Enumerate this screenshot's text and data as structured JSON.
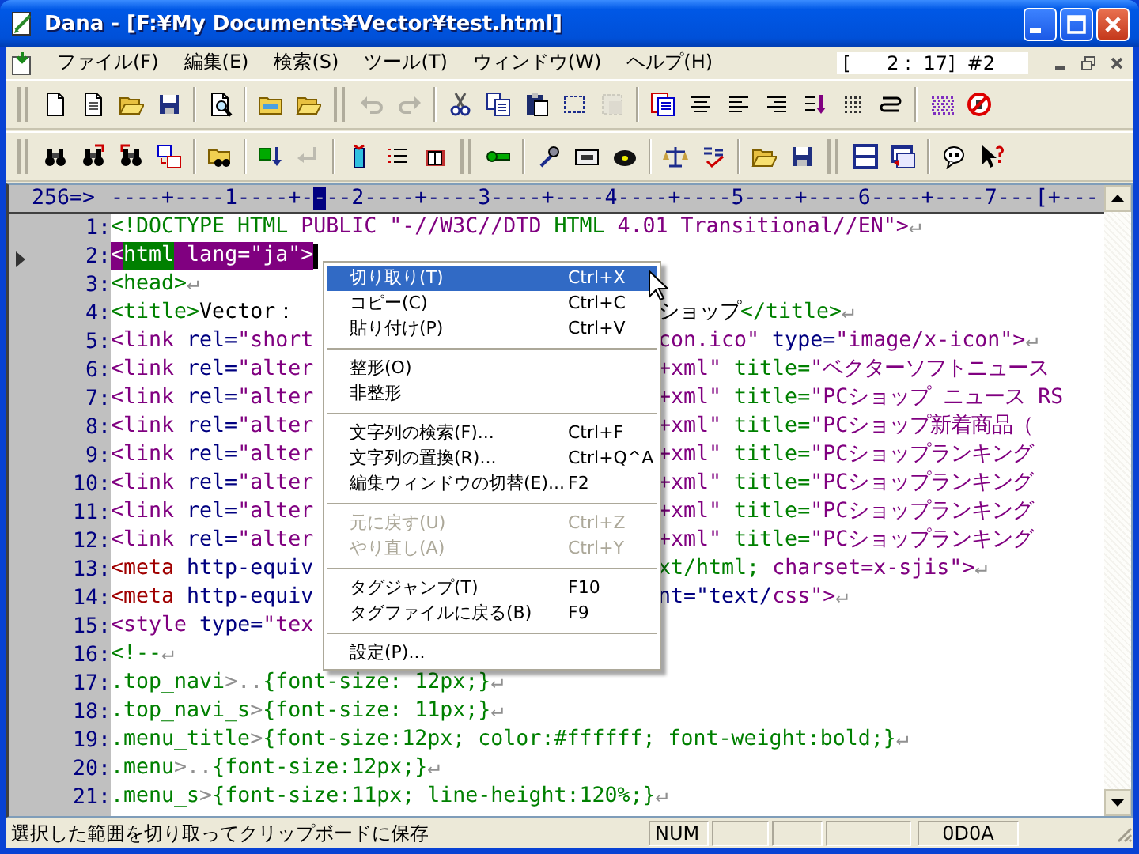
{
  "window": {
    "title": "Dana - [F:¥My Documents¥Vector¥test.html]"
  },
  "menu_bar": {
    "items": [
      "ファイル(F)",
      "編集(E)",
      "検索(S)",
      "ツール(T)",
      "ウィンドウ(W)",
      "ヘルプ(H)"
    ],
    "position": "[      2 :  17]  #2"
  },
  "toolbars": [
    {
      "groups": [
        {
          "buttons": [
            {
              "disabled": false
            },
            {
              "disabled": false
            },
            {
              "disabled": false
            },
            {
              "disabled": false
            }
          ]
        },
        {
          "buttons": [
            {
              "disabled": false
            }
          ]
        },
        {
          "buttons": [
            {
              "disabled": false
            },
            {
              "disabled": false
            }
          ]
        },
        {
          "buttons": [
            {
              "disabled": true
            },
            {
              "disabled": true
            }
          ]
        },
        {
          "buttons": [
            {
              "disabled": false
            },
            {
              "disabled": false
            },
            {
              "disabled": false
            },
            {
              "disabled": false
            },
            {
              "disabled": true
            }
          ]
        },
        {
          "buttons": [
            {
              "disabled": false
            },
            {
              "disabled": false
            },
            {
              "disabled": false
            },
            {
              "disabled": false
            },
            {
              "disabled": false
            },
            {
              "disabled": false
            },
            {
              "disabled": false
            }
          ]
        },
        {
          "buttons": [
            {
              "disabled": false
            },
            {
              "disabled": false
            }
          ]
        }
      ]
    },
    {
      "groups": [
        {
          "buttons": [
            {
              "disabled": false
            },
            {
              "disabled": false
            },
            {
              "disabled": false
            },
            {
              "disabled": false
            }
          ]
        },
        {
          "buttons": [
            {
              "disabled": false
            }
          ]
        },
        {
          "buttons": [
            {
              "disabled": false
            },
            {
              "disabled": true
            }
          ]
        },
        {
          "buttons": [
            {
              "disabled": false
            },
            {
              "disabled": false
            },
            {
              "disabled": false
            }
          ]
        },
        {
          "buttons": [
            {
              "disabled": false
            }
          ]
        },
        {
          "buttons": [
            {
              "disabled": false
            },
            {
              "disabled": false
            },
            {
              "disabled": false
            }
          ]
        },
        {
          "buttons": [
            {
              "disabled": false
            },
            {
              "disabled": false
            }
          ]
        },
        {
          "buttons": [
            {
              "disabled": false
            },
            {
              "disabled": false
            }
          ]
        },
        {
          "buttons": [
            {
              "disabled": false
            },
            {
              "disabled": false
            }
          ]
        },
        {
          "buttons": [
            {
              "disabled": false
            },
            {
              "disabled": false
            }
          ]
        }
      ]
    }
  ],
  "ruler": {
    "label": "256=>",
    "before": "----+----1----+-",
    "cursor": "-",
    "after": "--2----+----3----+----4----+----5----+----6----+----7---[+---"
  },
  "lines": [
    {
      "number": "1:",
      "current": false,
      "left": [
        {
          "kind": "tag",
          "text": "<!DOCTYPE HTML "
        },
        {
          "kind": "value",
          "text": "PUBLIC \"-//W3C//DTD "
        },
        {
          "kind": "tag",
          "text": "HTML "
        },
        {
          "kind": "value",
          "text": "4.01 Transitional//EN\">"
        },
        {
          "kind": "eol",
          "text": "↵"
        }
      ]
    },
    {
      "number": "2:",
      "current": true,
      "left": [
        {
          "kind": "value",
          "text": "<",
          "selected": true
        },
        {
          "kind": "tag",
          "text": "html",
          "selected": true
        },
        {
          "kind": "value",
          "text": " lang=\"ja\">",
          "selected": true
        }
      ]
    },
    {
      "number": "3:",
      "current": false,
      "left": [
        {
          "kind": "tag",
          "text": "<head>"
        },
        {
          "kind": "eol",
          "text": "↵"
        }
      ]
    },
    {
      "number": "4:",
      "current": false,
      "left": [
        {
          "kind": "tag",
          "text": "<title>"
        },
        {
          "kind": "text",
          "text": "Vector："
        }
      ],
      "right": [
        {
          "kind": "text",
          "text": "ショップ"
        },
        {
          "kind": "tag",
          "text": "</title>"
        },
        {
          "kind": "eol",
          "text": "↵"
        }
      ]
    },
    {
      "number": "5:",
      "current": false,
      "left": [
        {
          "kind": "value",
          "text": "<link"
        },
        {
          "kind": "attr",
          "text": " rel="
        },
        {
          "kind": "value",
          "text": "\"short"
        }
      ],
      "right": [
        {
          "kind": "value",
          "text": "con.ico\""
        },
        {
          "kind": "attr",
          "text": " type="
        },
        {
          "kind": "value",
          "text": "\"image/x-icon\">"
        },
        {
          "kind": "eol",
          "text": "↵"
        }
      ]
    },
    {
      "number": "6:",
      "current": false,
      "left": [
        {
          "kind": "value",
          "text": "<link"
        },
        {
          "kind": "attr",
          "text": " rel="
        },
        {
          "kind": "value",
          "text": "\"alter"
        }
      ],
      "right": [
        {
          "kind": "value",
          "text": "+xml\""
        },
        {
          "kind": "tag",
          "text": " title="
        },
        {
          "kind": "value",
          "text": "\"ベクターソフトニュース"
        }
      ]
    },
    {
      "number": "7:",
      "current": false,
      "left": [
        {
          "kind": "value",
          "text": "<link"
        },
        {
          "kind": "attr",
          "text": " rel="
        },
        {
          "kind": "value",
          "text": "\"alter"
        }
      ],
      "right": [
        {
          "kind": "value",
          "text": "+xml\""
        },
        {
          "kind": "tag",
          "text": " title="
        },
        {
          "kind": "value",
          "text": "\"PCショップ ニュース RS"
        }
      ]
    },
    {
      "number": "8:",
      "current": false,
      "left": [
        {
          "kind": "value",
          "text": "<link"
        },
        {
          "kind": "attr",
          "text": " rel="
        },
        {
          "kind": "value",
          "text": "\"alter"
        }
      ],
      "right": [
        {
          "kind": "value",
          "text": "+xml\""
        },
        {
          "kind": "tag",
          "text": " title="
        },
        {
          "kind": "value",
          "text": "\"PCショップ新着商品（"
        }
      ]
    },
    {
      "number": "9:",
      "current": false,
      "left": [
        {
          "kind": "value",
          "text": "<link"
        },
        {
          "kind": "attr",
          "text": " rel="
        },
        {
          "kind": "value",
          "text": "\"alter"
        }
      ],
      "right": [
        {
          "kind": "value",
          "text": "+xml\""
        },
        {
          "kind": "tag",
          "text": " title="
        },
        {
          "kind": "value",
          "text": "\"PCショップランキング"
        }
      ]
    },
    {
      "number": "10:",
      "current": false,
      "left": [
        {
          "kind": "value",
          "text": "<link"
        },
        {
          "kind": "attr",
          "text": " rel="
        },
        {
          "kind": "value",
          "text": "\"alter"
        }
      ],
      "right": [
        {
          "kind": "value",
          "text": "+xml\""
        },
        {
          "kind": "tag",
          "text": " title="
        },
        {
          "kind": "value",
          "text": "\"PCショップランキング"
        }
      ]
    },
    {
      "number": "11:",
      "current": false,
      "left": [
        {
          "kind": "value",
          "text": "<link"
        },
        {
          "kind": "attr",
          "text": " rel="
        },
        {
          "kind": "value",
          "text": "\"alter"
        }
      ],
      "right": [
        {
          "kind": "value",
          "text": "+xml\""
        },
        {
          "kind": "tag",
          "text": " title="
        },
        {
          "kind": "value",
          "text": "\"PCショップランキング"
        }
      ]
    },
    {
      "number": "12:",
      "current": false,
      "left": [
        {
          "kind": "value",
          "text": "<link"
        },
        {
          "kind": "attr",
          "text": " rel="
        },
        {
          "kind": "value",
          "text": "\"alter"
        }
      ],
      "right": [
        {
          "kind": "value",
          "text": "+xml\""
        },
        {
          "kind": "tag",
          "text": " title="
        },
        {
          "kind": "value",
          "text": "\"PCショップランキング"
        }
      ]
    },
    {
      "number": "13:",
      "current": false,
      "left": [
        {
          "kind": "meta",
          "text": "<meta"
        },
        {
          "kind": "attr",
          "text": " http-equiv"
        }
      ],
      "right": [
        {
          "kind": "tag",
          "text": "xt/html; "
        },
        {
          "kind": "value",
          "text": "charset=x-sjis\">"
        },
        {
          "kind": "eol",
          "text": "↵"
        }
      ]
    },
    {
      "number": "14:",
      "current": false,
      "left": [
        {
          "kind": "meta",
          "text": "<meta"
        },
        {
          "kind": "attr",
          "text": " http-equiv"
        }
      ],
      "right": [
        {
          "kind": "attr",
          "text": "nt=\"text/"
        },
        {
          "kind": "value",
          "text": "css\">"
        },
        {
          "kind": "eol",
          "text": "↵"
        }
      ]
    },
    {
      "number": "15:",
      "current": false,
      "left": [
        {
          "kind": "value",
          "text": "<style"
        },
        {
          "kind": "attr",
          "text": " type="
        },
        {
          "kind": "value",
          "text": "\"tex"
        }
      ]
    },
    {
      "number": "16:",
      "current": false,
      "left": [
        {
          "kind": "tag",
          "text": "<!--"
        },
        {
          "kind": "eol",
          "text": "↵"
        }
      ]
    },
    {
      "number": "17:",
      "current": false,
      "left": [
        {
          "kind": "tag",
          "text": ".top_navi"
        },
        {
          "kind": "eol",
          "text": ">.."
        },
        {
          "kind": "tag",
          "text": "{font-size: 12px;}"
        },
        {
          "kind": "eol",
          "text": "↵"
        }
      ]
    },
    {
      "number": "18:",
      "current": false,
      "left": [
        {
          "kind": "tag",
          "text": ".top_navi_s"
        },
        {
          "kind": "eol",
          "text": ">"
        },
        {
          "kind": "tag",
          "text": "{font-size: 11px;}"
        },
        {
          "kind": "eol",
          "text": "↵"
        }
      ]
    },
    {
      "number": "19:",
      "current": false,
      "left": [
        {
          "kind": "tag",
          "text": ".menu_title"
        },
        {
          "kind": "eol",
          "text": ">"
        },
        {
          "kind": "tag",
          "text": "{font-size:12px; color:#ffffff; font-weight:bold;}"
        },
        {
          "kind": "eol",
          "text": "↵"
        }
      ]
    },
    {
      "number": "20:",
      "current": false,
      "left": [
        {
          "kind": "tag",
          "text": ".menu"
        },
        {
          "kind": "eol",
          "text": ">.."
        },
        {
          "kind": "tag",
          "text": "{font-size:12px;}"
        },
        {
          "kind": "eol",
          "text": "↵"
        }
      ]
    },
    {
      "number": "21:",
      "current": false,
      "left": [
        {
          "kind": "tag",
          "text": ".menu_s"
        },
        {
          "kind": "eol",
          "text": ">"
        },
        {
          "kind": "tag",
          "text": "{font-size:11px; line-height:120%;}"
        },
        {
          "kind": "eol",
          "text": "↵"
        }
      ]
    }
  ],
  "context_menu": {
    "items": [
      {
        "kind": "item",
        "label": "切り取り(T)",
        "shortcut": "Ctrl+X",
        "selected": true,
        "disabled": false
      },
      {
        "kind": "item",
        "label": "コピー(C)",
        "shortcut": "Ctrl+C",
        "selected": false,
        "disabled": false
      },
      {
        "kind": "item",
        "label": "貼り付け(P)",
        "shortcut": "Ctrl+V",
        "selected": false,
        "disabled": false
      },
      {
        "kind": "separator"
      },
      {
        "kind": "item",
        "label": "整形(O)",
        "selected": false,
        "disabled": false
      },
      {
        "kind": "item",
        "label": "非整形",
        "selected": false,
        "disabled": false
      },
      {
        "kind": "separator"
      },
      {
        "kind": "item",
        "label": "文字列の検索(F)...",
        "shortcut": "Ctrl+F",
        "selected": false,
        "disabled": false
      },
      {
        "kind": "item",
        "label": "文字列の置換(R)...",
        "shortcut": "Ctrl+Q^A",
        "selected": false,
        "disabled": false
      },
      {
        "kind": "item",
        "label": "編集ウィンドウの切替(E)...",
        "shortcut": "F2",
        "selected": false,
        "disabled": false
      },
      {
        "kind": "separator"
      },
      {
        "kind": "item",
        "label": "元に戻す(U)",
        "shortcut": "Ctrl+Z",
        "selected": false,
        "disabled": true
      },
      {
        "kind": "item",
        "label": "やり直し(A)",
        "shortcut": "Ctrl+Y",
        "selected": false,
        "disabled": true
      },
      {
        "kind": "separator"
      },
      {
        "kind": "item",
        "label": "タグジャンプ(T)",
        "shortcut": "F10",
        "selected": false,
        "disabled": false
      },
      {
        "kind": "item",
        "label": "タグファイルに戻る(B)",
        "shortcut": "F9",
        "selected": false,
        "disabled": false
      },
      {
        "kind": "separator"
      },
      {
        "kind": "item",
        "label": "設定(P)...",
        "selected": false,
        "disabled": false
      }
    ]
  },
  "status_bar": {
    "message": "選択した範囲を切り取ってクリップボードに保存",
    "num_lock": "NUM",
    "line_ending": "0D0A"
  }
}
